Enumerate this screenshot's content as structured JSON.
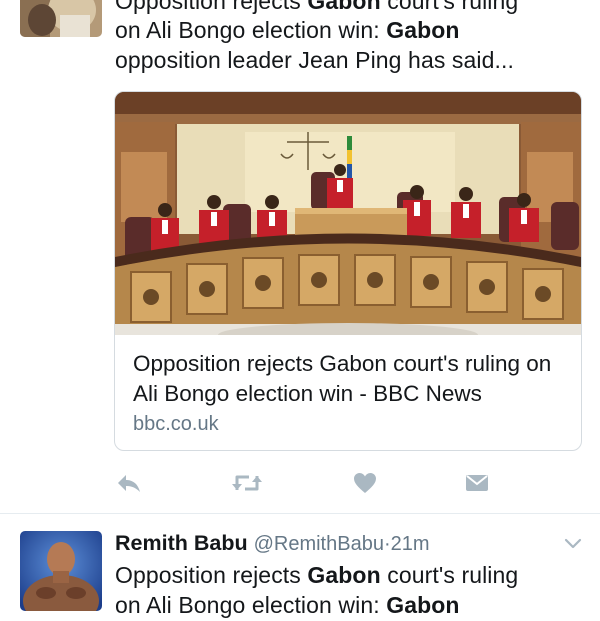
{
  "tweet1": {
    "text_line1_pre": "Opposition rejects ",
    "text_line1_bold": "Gabon",
    "text_line1_post": " court's ruling",
    "text_line2_pre": "on Ali Bongo election win: ",
    "text_line2_bold": "Gabon",
    "text_line3": "opposition leader Jean Ping has said...",
    "card": {
      "image_icon": "courtroom-photo",
      "title": "Opposition rejects Gabon court's ruling on Ali Bongo election win - BBC News",
      "domain": "bbc.co.uk"
    },
    "actions": {
      "reply_icon": "reply-icon",
      "retweet_icon": "retweet-icon",
      "like_icon": "heart-icon",
      "dm_icon": "envelope-icon"
    }
  },
  "tweet2": {
    "name": "Remith Babu",
    "handle": "@RemithBabu",
    "separator": "·",
    "time": "21m",
    "text_line1_pre": "Opposition rejects ",
    "text_line1_bold": "Gabon",
    "text_line1_post": " court's ruling",
    "text_line2_pre": "on Ali Bongo election win: ",
    "text_line2_bold": "Gabon",
    "menu_icon": "chevron-down-icon"
  },
  "colors": {
    "text": "#14171a",
    "secondary": "#657786",
    "icon": "#aab8c2",
    "border": "#d5dbe0"
  }
}
